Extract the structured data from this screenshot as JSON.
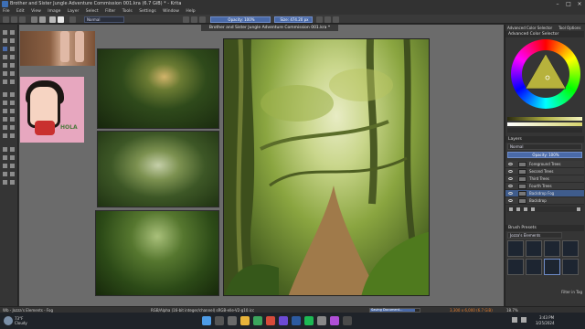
{
  "window": {
    "title": "Brother and Sister Jungle Adventure Commission 001.kra (6.7 GiB) * - Krita"
  },
  "menu": [
    "File",
    "Edit",
    "View",
    "Image",
    "Layer",
    "Select",
    "Filter",
    "Tools",
    "Settings",
    "Window",
    "Help"
  ],
  "toolbar": {
    "blend_mode": "Normal",
    "opacity_label": "Opacity: 100%",
    "size_label": "Size: 474.20 px"
  },
  "document": {
    "tab_title": "Brother and Sister Jungle Adventure Commission 001.kra *"
  },
  "reference": {
    "sticker_text": "HOLA"
  },
  "dock": {
    "top_tabs": [
      "Advanced Color Selector",
      "Tool Options"
    ],
    "color_panel_title": "Advanced Color Selector",
    "layers_title": "Layers",
    "blend_mode": "Normal",
    "opacity_label": "Opacity: 100%",
    "layers": [
      {
        "name": "Foreground Trees",
        "selected": false
      },
      {
        "name": "Second Trees",
        "selected": false
      },
      {
        "name": "Third Trees",
        "selected": false
      },
      {
        "name": "Fourth Trees",
        "selected": false
      },
      {
        "name": "Backdrop Fog",
        "selected": true
      },
      {
        "name": "Backdrop",
        "selected": false
      }
    ],
    "brush_presets_title": "Brush Presets",
    "brush_tag": "Jozza's Elements",
    "filter_tag": "Filter in Tag"
  },
  "status": {
    "left": "Wb - Jozza's Elements - Fog",
    "center": "RGB/Alpha (16-bit integer/channel) sRGB-elle-V2-g10.icc",
    "saving": "Saving Document...",
    "progress_percent": 90,
    "size": "3,300 x 6,000 (6.7 GiB)",
    "zoom": "18.7%"
  },
  "taskbar": {
    "weather_temp": "73°F",
    "weather_text": "Cloudy",
    "time": "3:43 PM",
    "date": "3/25/2024"
  },
  "colors": {
    "accent": "#4a6aa8",
    "selected_layer": "#3f5c8c"
  }
}
